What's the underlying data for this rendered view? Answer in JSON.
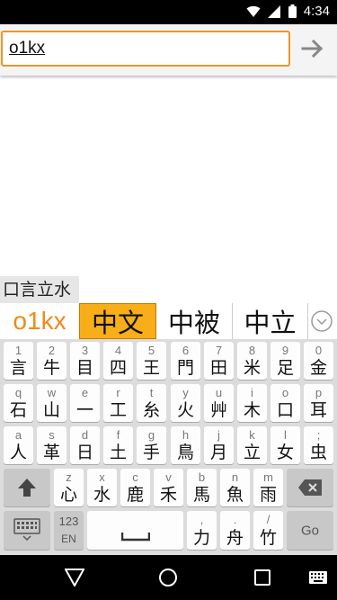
{
  "status": {
    "time": "4:34"
  },
  "search": {
    "value": "o1kx"
  },
  "ime": {
    "composition": "口言立水",
    "raw_input": "o1kx",
    "candidates": [
      "中文",
      "中被",
      "中立"
    ]
  },
  "keyboard": {
    "rows": [
      [
        {
          "top": "1",
          "bot": "言"
        },
        {
          "top": "2",
          "bot": "牛"
        },
        {
          "top": "3",
          "bot": "目"
        },
        {
          "top": "4",
          "bot": "四"
        },
        {
          "top": "5",
          "bot": "王"
        },
        {
          "top": "6",
          "bot": "門"
        },
        {
          "top": "7",
          "bot": "田"
        },
        {
          "top": "8",
          "bot": "米"
        },
        {
          "top": "9",
          "bot": "足"
        },
        {
          "top": "0",
          "bot": "金"
        }
      ],
      [
        {
          "top": "q",
          "bot": "石"
        },
        {
          "top": "w",
          "bot": "山"
        },
        {
          "top": "e",
          "bot": "一"
        },
        {
          "top": "r",
          "bot": "工"
        },
        {
          "top": "t",
          "bot": "糸"
        },
        {
          "top": "y",
          "bot": "火"
        },
        {
          "top": "u",
          "bot": "艸"
        },
        {
          "top": "i",
          "bot": "木"
        },
        {
          "top": "o",
          "bot": "口"
        },
        {
          "top": "p",
          "bot": "耳"
        }
      ],
      [
        {
          "top": "a",
          "bot": "人"
        },
        {
          "top": "s",
          "bot": "革"
        },
        {
          "top": "d",
          "bot": "日"
        },
        {
          "top": "f",
          "bot": "土"
        },
        {
          "top": "g",
          "bot": "手"
        },
        {
          "top": "h",
          "bot": "鳥"
        },
        {
          "top": "j",
          "bot": "月"
        },
        {
          "top": "k",
          "bot": "立"
        },
        {
          "top": "l",
          "bot": "女"
        },
        {
          "top": ";",
          "bot": "虫"
        }
      ],
      [
        {
          "top": "z",
          "bot": "心"
        },
        {
          "top": "x",
          "bot": "水"
        },
        {
          "top": "c",
          "bot": "鹿"
        },
        {
          "top": "v",
          "bot": "禾"
        },
        {
          "top": "b",
          "bot": "馬"
        },
        {
          "top": "n",
          "bot": "魚"
        },
        {
          "top": "m",
          "bot": "雨"
        }
      ]
    ],
    "mode_top": "123",
    "mode_bot": "EN",
    "comma": {
      "top": ",",
      "bot": "力"
    },
    "period": {
      "top": ".",
      "bot": "舟"
    },
    "slash": {
      "top": "/",
      "bot": "竹"
    },
    "go_label": "Go"
  }
}
